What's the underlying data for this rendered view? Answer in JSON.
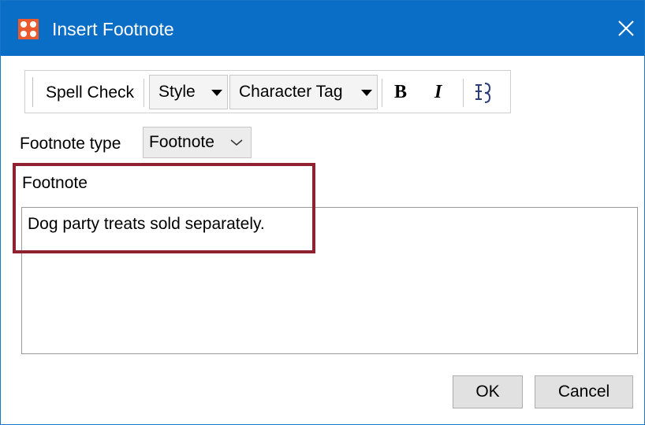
{
  "window": {
    "title": "Insert Footnote",
    "app_icon": "app-logo-icon",
    "close_icon": "close-icon",
    "titlebar_color": "#0a6dc6",
    "app_icon_color": "#ea5a2c"
  },
  "toolbar": {
    "spell_check": "Spell Check",
    "style": "Style",
    "character_tag": "Character Tag",
    "bold_icon": "B",
    "italic_icon": "I",
    "special_char_icon": "special-character-icon"
  },
  "footnote_type": {
    "label": "Footnote type",
    "value": "Footnote"
  },
  "footnote": {
    "label": "Footnote",
    "text": "Dog party treats sold separately."
  },
  "buttons": {
    "ok": "OK",
    "cancel": "Cancel"
  },
  "annotation": {
    "highlight_color": "#8f2230"
  }
}
